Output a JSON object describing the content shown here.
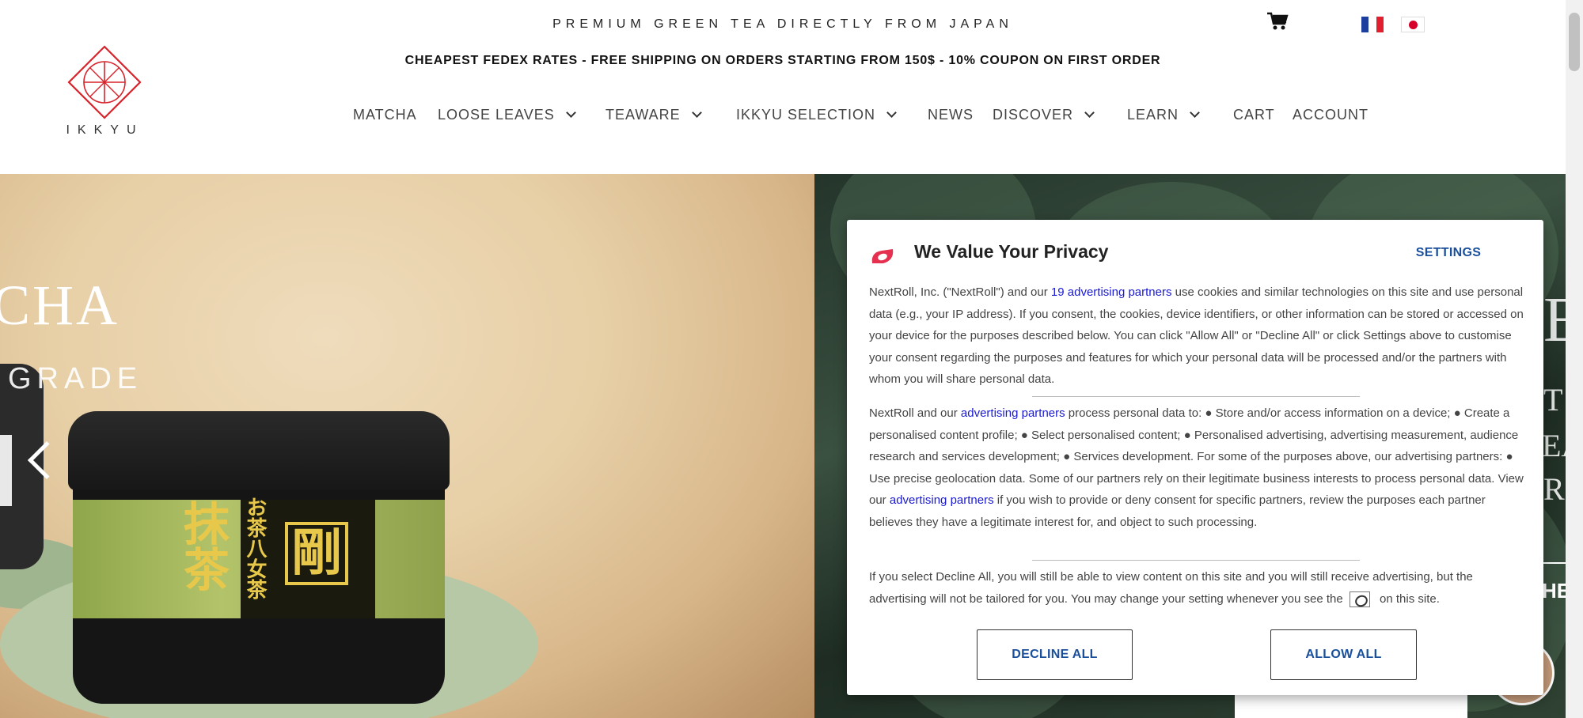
{
  "header": {
    "tagline": "PREMIUM GREEN TEA DIRECTLY FROM JAPAN",
    "promo": "CHEAPEST FEDEX RATES - FREE SHIPPING ON ORDERS STARTING FROM 150$ - 10% COUPON ON FIRST ORDER",
    "logo_text": "IKKYU",
    "icons": {
      "cart": "shopping-cart-icon",
      "flag_fr": "france-flag",
      "flag_jp": "japan-flag"
    }
  },
  "nav": {
    "items": [
      {
        "label": "MATCHA",
        "dropdown": false
      },
      {
        "label": "LOOSE LEAVES",
        "dropdown": true
      },
      {
        "label": "TEAWARE",
        "dropdown": true
      },
      {
        "label": "IKKYU SELECTION",
        "dropdown": true
      },
      {
        "label": "NEWS",
        "dropdown": false
      },
      {
        "label": "DISCOVER",
        "dropdown": true
      },
      {
        "label": "LEARN",
        "dropdown": true
      },
      {
        "label": "CART",
        "dropdown": false
      },
      {
        "label": "ACCOUNT",
        "dropdown": false
      }
    ]
  },
  "hero": {
    "title": "CHA",
    "subtitle": "GRADE",
    "can_kanji_main": "抹茶",
    "can_kanji_side": "お茶八女茶",
    "can_kanji_box": "剛",
    "right_fragments": [
      "E",
      "T",
      "EA",
      "R",
      "HE"
    ]
  },
  "privacy": {
    "title": "We Value Your Privacy",
    "settings": "SETTINGS",
    "para1_a": "NextRoll, Inc. (\"NextRoll\") and our ",
    "para1_link": "19 advertising partners",
    "para1_b": " use cookies and similar technologies on this site and use personal data (e.g., your IP address). If you consent, the cookies, device identifiers, or other information can be stored or accessed on your device for the purposes described below. You can click \"Allow All\" or \"Decline All\" or click Settings above to customise your consent regarding the purposes and features for which your personal data will be processed and/or the partners with whom you will share personal data.",
    "para2_a": "NextRoll and our ",
    "para2_link1": "advertising partners",
    "para2_b": " process personal data to: ● Store and/or access information on a device; ● Create a personalised content profile; ● Select personalised content; ● Personalised advertising, advertising measurement, audience research and services development; ● Services development. For some of the purposes above, our advertising partners: ● Use precise geolocation data. Some of our partners rely on their legitimate business interests to process personal data. View our ",
    "para2_link2": "advertising partners",
    "para2_c": " if you wish to provide or deny consent for specific partners, review the purposes each partner believes they have a legitimate interest for, and object to such processing.",
    "para3_a": "If you select Decline All, you will still be able to view content on this site and you will still receive advertising, but the advertising will not be tailored for you. You may change your setting whenever you see the ",
    "para3_b": " on this site.",
    "decline": "DECLINE ALL",
    "allow": "ALLOW ALL"
  },
  "colors": {
    "logo_red": "#d8232a",
    "link_blue": "#1a1ad6",
    "button_blue": "#1a4f9c"
  }
}
